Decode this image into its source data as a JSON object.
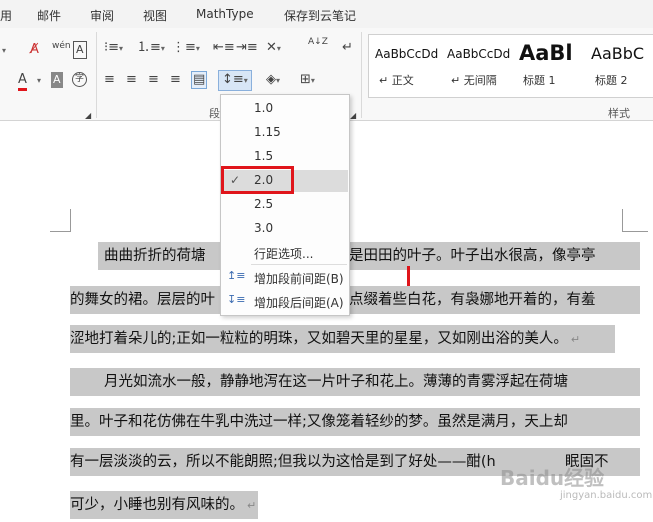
{
  "tabs": [
    "用",
    "邮件",
    "审阅",
    "视图",
    "MathType",
    "保存到云笔记"
  ],
  "ribbon": {
    "group_paragraph_label": "段",
    "group_styles_label": "样式",
    "icons": {
      "pinyin_glyph": "wén",
      "sort_glyph": "A↓Z",
      "char_shading_glyph": "A",
      "enclosed_char_glyph": "字"
    }
  },
  "styles": [
    {
      "preview": "AaBbCcDd",
      "name": "↵ 正文"
    },
    {
      "preview": "AaBbCcDd",
      "name": "↵ 无间隔"
    },
    {
      "preview": "AaBl",
      "name": "标题 1"
    },
    {
      "preview": "AaBbC",
      "name": "标题 2"
    }
  ],
  "line_spacing_menu": {
    "options": [
      "1.0",
      "1.15",
      "1.5",
      "2.0",
      "2.5",
      "3.0"
    ],
    "selected": "2.0",
    "more_options": "行距选项...",
    "add_before": "增加段前间距(B)",
    "add_after": "增加段后间距(A)"
  },
  "document": {
    "lines": [
      "曲曲折折的荷塘",
      "是田田的叶子。叶子出水很高，像亭亭",
      "的舞女的裙。层层的叶",
      "点缀着些白花，有袅娜地开着的，有羞",
      "涩地打着朵儿的;正如一粒粒的明珠，又如碧天里的星星，又如刚出浴的美人。",
      "月光如流水一般，静静地泻在这一片叶子和花上。薄薄的青雾浮起在荷塘",
      "里。叶子和花仿佛在牛乳中洗过一样;又像笼着轻纱的梦。虽然是满月，天上却",
      "有一层淡淡的云，所以不能朗照;但我以为这恰是到了好处——酣(h",
      "眠固不",
      "可少，小睡也别有风味的。"
    ],
    "para_mark": "↵"
  },
  "watermark": {
    "main": "Baidu经验",
    "sub": "jingyan.baidu.com"
  },
  "colors": {
    "accent_red": "#e0151b",
    "selection_gray": "#c8c8c8"
  }
}
